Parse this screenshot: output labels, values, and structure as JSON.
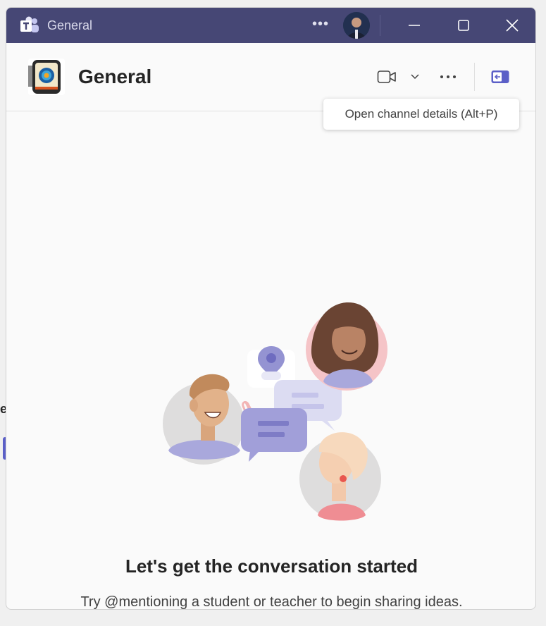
{
  "window": {
    "title": "General"
  },
  "background": {
    "peek_text": "e"
  },
  "header": {
    "channel_name": "General"
  },
  "tooltip": {
    "text": "Open channel details (Alt+P)"
  },
  "empty_state": {
    "title": "Let's get the conversation started",
    "subtitle": "Try @mentioning a student or teacher to begin sharing ideas."
  },
  "icons": {
    "app": "microsoft-teams-icon",
    "more": "more-horizontal-icon",
    "minimize": "minimize-icon",
    "maximize": "maximize-icon",
    "close": "close-icon",
    "video": "video-camera-icon",
    "chevron": "chevron-down-icon",
    "details": "channel-details-panel-icon"
  },
  "colors": {
    "titlebar": "#464775",
    "accent": "#5b5fc7"
  }
}
